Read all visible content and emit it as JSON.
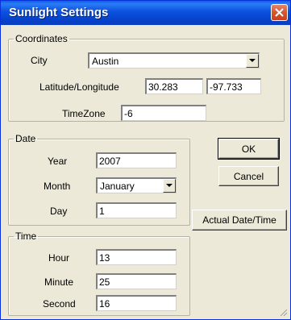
{
  "window": {
    "title": "Sunlight Settings",
    "close_icon": "close-icon",
    "colors": {
      "titlebar": "#0b52df",
      "close": "#d8552d",
      "face": "#ece9d8"
    }
  },
  "coordinates": {
    "legend": "Coordinates",
    "city_label": "City",
    "city_value": "Austin",
    "latlong_label": "Latitude/Longitude",
    "latitude": "30.283",
    "separator": "/",
    "longitude": "-97.733",
    "timezone_label": "TimeZone",
    "timezone": "-6"
  },
  "date": {
    "legend": "Date",
    "year_label": "Year",
    "year": "2007",
    "month_label": "Month",
    "month_value": "January",
    "day_label": "Day",
    "day": "1"
  },
  "time": {
    "legend": "Time",
    "hour_label": "Hour",
    "hour": "13",
    "minute_label": "Minute",
    "minute": "25",
    "second_label": "Second",
    "second": "16"
  },
  "buttons": {
    "ok": "OK",
    "cancel": "Cancel",
    "actual": "Actual Date/Time"
  }
}
